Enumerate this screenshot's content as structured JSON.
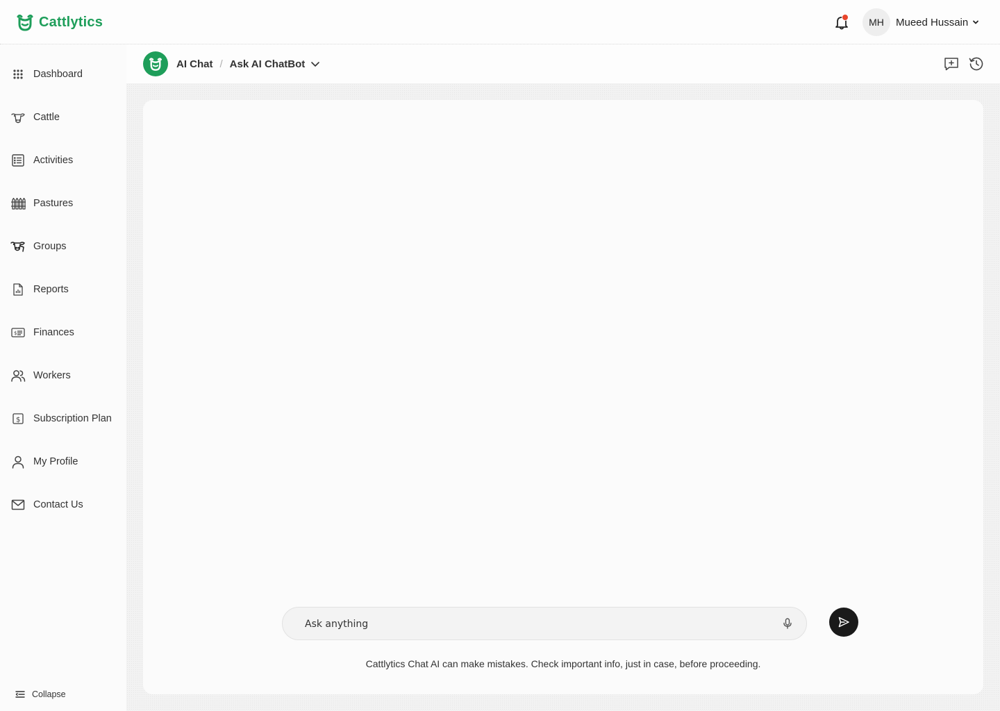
{
  "app": {
    "brand_name": "Cattlytics",
    "brand_color": "#1e9e5a"
  },
  "header": {
    "notification_icon": "bell-icon",
    "notification_badge_color": "#e8452c",
    "user_initials": "MH",
    "user_name": "Mueed Hussain"
  },
  "sidebar": {
    "items": [
      {
        "label": "Dashboard",
        "icon": "grid-dots-icon"
      },
      {
        "label": "Cattle",
        "icon": "cow-head-icon"
      },
      {
        "label": "Activities",
        "icon": "checklist-icon"
      },
      {
        "label": "Pastures",
        "icon": "fence-icon"
      },
      {
        "label": "Groups",
        "icon": "cattle-group-icon"
      },
      {
        "label": "Reports",
        "icon": "report-icon"
      },
      {
        "label": "Finances",
        "icon": "money-card-icon"
      },
      {
        "label": "Workers",
        "icon": "users-icon"
      },
      {
        "label": "Subscription Plan",
        "icon": "dollar-icon"
      },
      {
        "label": "My Profile",
        "icon": "user-icon"
      },
      {
        "label": "Contact Us",
        "icon": "mail-icon"
      }
    ],
    "collapse_label": "Collapse"
  },
  "subheader": {
    "breadcrumb_root": "AI Chat",
    "breadcrumb_separator": "/",
    "breadcrumb_current": "Ask AI ChatBot"
  },
  "chat": {
    "input_placeholder": "Ask anything",
    "disclaimer": "Cattlytics Chat AI can make mistakes. Check important info, just in case, before proceeding."
  }
}
